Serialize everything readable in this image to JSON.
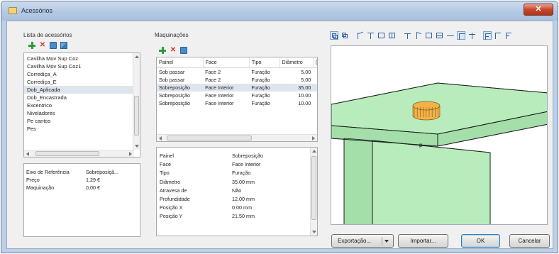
{
  "window": {
    "title": "Acessórios",
    "close_label": "✕"
  },
  "accessories": {
    "label": "Lista de acessórios",
    "items": [
      {
        "label": "Cavilha Mov Sup Coz",
        "selected": false
      },
      {
        "label": "Cavilha Mov Sup Coz1",
        "selected": false
      },
      {
        "label": "Corrediça_A",
        "selected": false
      },
      {
        "label": "Corrediça_E",
        "selected": false
      },
      {
        "label": "Dob_Aplicada",
        "selected": true
      },
      {
        "label": "Dob_Encastrada",
        "selected": false
      },
      {
        "label": "Excentrico",
        "selected": false
      },
      {
        "label": "Niveladores",
        "selected": false
      },
      {
        "label": "Pe cantos",
        "selected": false
      },
      {
        "label": "Pes",
        "selected": false
      }
    ]
  },
  "accessory_info": {
    "rows": [
      {
        "key": "Eixo de Referência",
        "value": "Sobreposiçã..."
      },
      {
        "key": "Preço",
        "value": "1,29 €"
      },
      {
        "key": "Maquinação",
        "value": "0,00 €"
      }
    ]
  },
  "machining": {
    "label": "Maquinações",
    "columns": [
      "Painel",
      "Face",
      "Tipo",
      "Diâmetro",
      "("
    ],
    "rows": [
      {
        "painel": "Sob passar",
        "face": "Face 2",
        "tipo": "Furação",
        "diametro": "5.00",
        "selected": false
      },
      {
        "painel": "Sob passar",
        "face": "Face 2",
        "tipo": "Furação",
        "diametro": "5.00",
        "selected": false
      },
      {
        "painel": "Sobreposição",
        "face": "Face Interior",
        "tipo": "Furação",
        "diametro": "35.00",
        "selected": true
      },
      {
        "painel": "Sobreposição",
        "face": "Face Interior",
        "tipo": "Furação",
        "diametro": "10.00",
        "selected": false
      },
      {
        "painel": "Sobreposição",
        "face": "Face Interior",
        "tipo": "Furação",
        "diametro": "10.00",
        "selected": false
      }
    ]
  },
  "properties": {
    "rows": [
      {
        "key": "Painel",
        "value": "Sobreposição"
      },
      {
        "key": "Face",
        "value": "Face Interior"
      },
      {
        "key": "Tipo",
        "value": "Furação"
      },
      {
        "key": "Diâmetro",
        "value": "35.00 mm"
      },
      {
        "key": "Atravesa de",
        "value": "Não"
      },
      {
        "key": "Profundidade",
        "value": "12.00 mm"
      },
      {
        "key": "Posição X",
        "value": "0.00 mm"
      },
      {
        "key": "Posição Y",
        "value": "21.50 mm"
      }
    ]
  },
  "viewport": {
    "panel_label": "p"
  },
  "buttons": {
    "export": "Exportação...",
    "import": "Importar...",
    "ok": "OK",
    "cancel": "Cancelar"
  },
  "colors": {
    "panel_fill": "#b8ecbc",
    "panel_fill_dark": "#a4dea9",
    "panel_edge": "#1c1c1c",
    "hinge_cup": "#f2b24a",
    "selection": "#dfe5ec"
  }
}
